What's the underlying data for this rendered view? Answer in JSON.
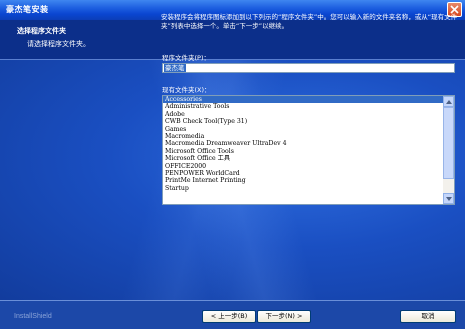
{
  "window": {
    "title": "豪杰笔安装"
  },
  "header": {
    "title": "选择程序文件夹",
    "subtitle": "请选择程序文件夹。"
  },
  "main": {
    "intro": "安装程序会将程序图标添加到以下列示的“程序文件夹”中。您可以输入新的文件夹名称，或从“现有文件夹”列表中选择一个。单击“下一步”以继续。",
    "program_folder_label": "程序文件夹(P)：",
    "program_folder_value": "豪杰笔",
    "existing_folders_label": "现有文件夹(X)：",
    "existing_folders": [
      "Accessories",
      "Administrative Tools",
      "Adobe",
      "CWB Check Tool(Type 31)",
      "Games",
      "Macromedia",
      "Macromedia Dreamweaver UltraDev 4",
      "Microsoft Office Tools",
      "Microsoft Office 工具",
      "OFFICE2000",
      "PENPOWER WorldCard",
      "PrintMe Internet Printing",
      "Startup"
    ],
    "selected_index": 0
  },
  "footer": {
    "brand": "InstallShield",
    "back_label": "< 上一步(B)",
    "next_label": "下一步(N) >",
    "cancel_label": "取消"
  },
  "colors": {
    "title_bar": "#0a46d1",
    "header_band": "#0c2f8a",
    "selection": "#316ac5"
  }
}
